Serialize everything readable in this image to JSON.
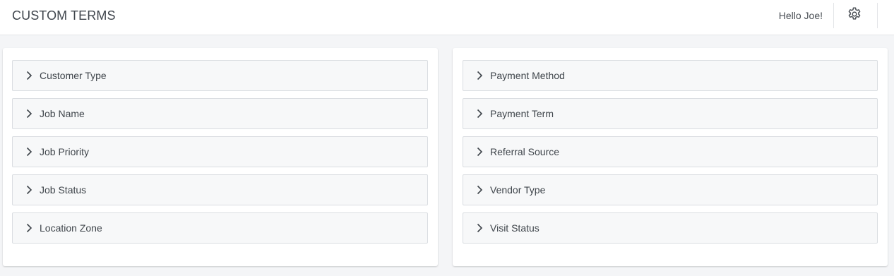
{
  "header": {
    "title": "CUSTOM TERMS",
    "greeting": "Hello Joe!",
    "settings_icon": "gear-icon"
  },
  "left_panel": {
    "items": [
      {
        "label": "Customer Type"
      },
      {
        "label": "Job Name"
      },
      {
        "label": "Job Priority"
      },
      {
        "label": "Job Status"
      },
      {
        "label": "Location Zone"
      }
    ]
  },
  "right_panel": {
    "items": [
      {
        "label": "Payment Method"
      },
      {
        "label": "Payment Term"
      },
      {
        "label": "Referral Source"
      },
      {
        "label": "Vendor Type"
      },
      {
        "label": "Visit Status"
      }
    ]
  },
  "colors": {
    "background": "#f4f5f7",
    "panel": "#ffffff",
    "accordion_bg": "#f7f8f9",
    "accordion_border": "#dadde1",
    "text": "#3f454b"
  }
}
